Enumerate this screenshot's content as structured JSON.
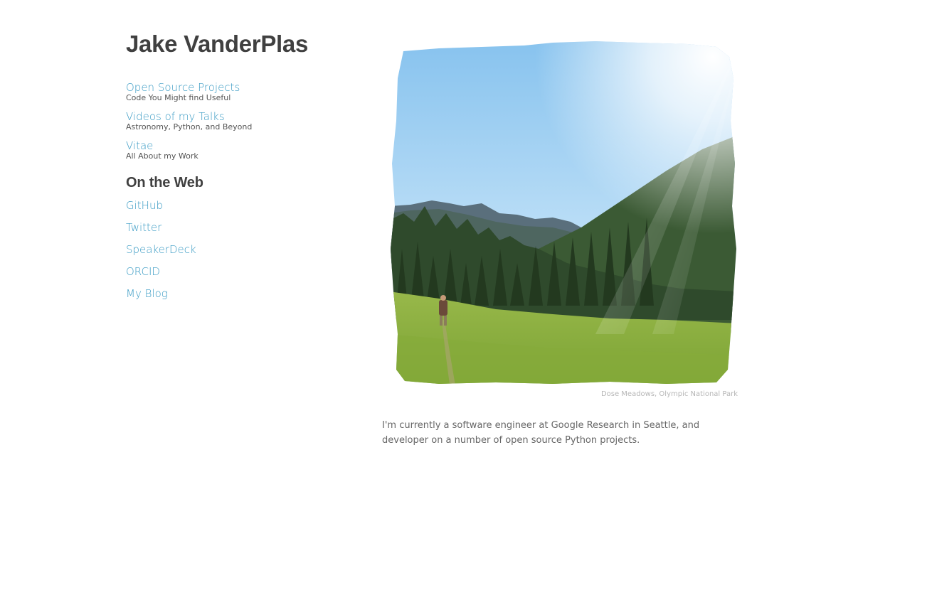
{
  "site": {
    "title": "Jake VanderPlas"
  },
  "nav": {
    "items": [
      {
        "label": "Open Source Projects",
        "subtitle": "Code You Might find Useful"
      },
      {
        "label": "Videos of my Talks",
        "subtitle": "Astronomy, Python, and Beyond"
      },
      {
        "label": "Vitae",
        "subtitle": "All About my Work"
      }
    ]
  },
  "web": {
    "heading": "On the Web",
    "links": [
      {
        "label": "GitHub"
      },
      {
        "label": "Twitter"
      },
      {
        "label": "SpeakerDeck"
      },
      {
        "label": "ORCID"
      },
      {
        "label": "My Blog"
      }
    ]
  },
  "photo": {
    "caption": "Dose Meadows, Olympic National Park"
  },
  "bio": {
    "text": "I'm currently a software engineer at Google Research in Seattle, and developer on a number of open source Python projects."
  },
  "colors": {
    "link": "#3a9bc4",
    "heading": "#404040",
    "sky_top": "#8ec6ee",
    "meadow": "#8fb13e",
    "forest": "#2d4a2a"
  }
}
